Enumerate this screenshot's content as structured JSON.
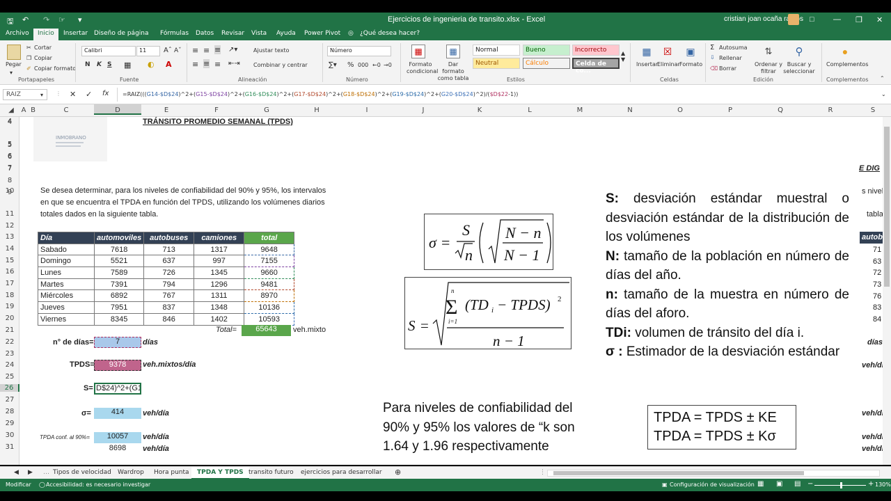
{
  "title_bar": {
    "window_title": "Ejercicios de ingenieria de transito.xlsx  -  Excel",
    "user": "cristian joan ocaña ramos"
  },
  "menu_tabs": [
    "Archivo",
    "Inicio",
    "Insertar",
    "Diseño de página",
    "Fórmulas",
    "Datos",
    "Revisar",
    "Vista",
    "Ayuda",
    "Power Pivot",
    "¿Qué desea hacer?"
  ],
  "ribbon": {
    "clipboard": {
      "paste": "Pegar",
      "cut": "Cortar",
      "copy": "Copiar",
      "format_painter": "Copiar formato",
      "group": "Portapapeles"
    },
    "font": {
      "name": "Calibri",
      "size": "11",
      "bold": "N",
      "italic": "K",
      "underline": "S",
      "group": "Fuente"
    },
    "alignment": {
      "wrap": "Ajustar texto",
      "merge": "Combinar y centrar",
      "group": "Alineación"
    },
    "number": {
      "format": "Número",
      "group": "Número"
    },
    "styles": {
      "conditional": "Formato condicional",
      "table": "Dar formato como tabla",
      "normal": "Normal",
      "good": "Bueno",
      "bad": "Incorrecto",
      "neutral": "Neutral",
      "calc": "Cálculo",
      "check": "Celda de co...",
      "group": "Estilos"
    },
    "cells": {
      "insert": "Insertar",
      "delete": "Eliminar",
      "format": "Formato",
      "group": "Celdas"
    },
    "editing": {
      "autosum": "Autosuma",
      "fill": "Rellenar",
      "clear": "Borrar",
      "sort": "Ordenar y filtrar",
      "find": "Buscar y seleccionar",
      "group": "Edición"
    },
    "addins": {
      "label": "Complementos",
      "group": "Complementos"
    }
  },
  "formula_bar": {
    "name_box": "RAIZ",
    "fx": "fx",
    "parts": [
      "=RAIZ(((",
      "G14-$D$24",
      ")^2+(",
      "G15-$D$24",
      ")^2+(",
      "G16-$D$24",
      ")^2+(",
      "G17-$D$24",
      ")^2+(",
      "G18-$D$24",
      ")^2+(",
      "G19-$D$24",
      ")^2+(",
      "G20-$D$24",
      ")^2)/(",
      "$D$22",
      "-1))"
    ]
  },
  "columns": [
    "A",
    "B",
    "C",
    "D",
    "E",
    "F",
    "G",
    "H",
    "I",
    "J",
    "K",
    "L",
    "M",
    "N",
    "O",
    "P",
    "Q",
    "R",
    "S"
  ],
  "rows": [
    "4",
    "5",
    "6",
    "7",
    "8",
    "9",
    "10",
    "11",
    "12",
    "13",
    "14",
    "15",
    "16",
    "17",
    "18",
    "19",
    "20",
    "21",
    "22",
    "23",
    "24",
    "25",
    "26",
    "27",
    "28",
    "29",
    "30",
    "31"
  ],
  "sheet": {
    "logo": "INMOBRANO",
    "heading": "TRÁNSITO PROMEDIO SEMANAL (TPDS)",
    "right_cut": "E DIG",
    "intro": [
      "Se desea determinar, para los niveles de confiabilidad del 90% y 95%, los intervalos",
      "en que se encuentra el TPDA en función del TPDS, utilizando los volúmenes diarios",
      "totales dados en la siguiente tabla."
    ],
    "table": {
      "headers": [
        "Día",
        "automoviles",
        "autobuses",
        "camiones",
        "total"
      ],
      "rows": [
        [
          "Sabado",
          "7618",
          "713",
          "1317",
          "9648"
        ],
        [
          "Domingo",
          "5521",
          "637",
          "997",
          "7155"
        ],
        [
          "Lunes",
          "7589",
          "726",
          "1345",
          "9660"
        ],
        [
          "Martes",
          "7391",
          "794",
          "1296",
          "9481"
        ],
        [
          "Miércoles",
          "6892",
          "767",
          "1311",
          "8970"
        ],
        [
          "Jueves",
          "7951",
          "837",
          "1348",
          "10136"
        ],
        [
          "Viernes",
          "8345",
          "846",
          "1402",
          "10593"
        ]
      ],
      "total_label": "Total=",
      "total_value": "65643",
      "total_unit": "veh.mixto"
    },
    "calc": {
      "ndias_label": "n° de días=",
      "ndias_value": "7",
      "ndias_unit": "días",
      "tpds_label": "TPDS=",
      "tpds_value": "9378",
      "tpds_unit": "veh.mixtos/día",
      "s_label": "S=",
      "s_value": "D$24)^2+(G1",
      "sigma_label": "σ=",
      "sigma_value": "414",
      "sigma_unit": "veh/día",
      "tpda90_label": "TPDA conf. al 90%=",
      "tpda90_value": "10057",
      "tpda90_unit": "veh/día",
      "tpda90_low": "8698",
      "tpda90_low_unit": "veh/día"
    },
    "definitions": [
      {
        "term": "S:",
        "text": " desviación estándar muestral o desviación estándar de la distribución de los volúmenes"
      },
      {
        "term": "N:",
        "text": " tamaño de la población en número de días del año."
      },
      {
        "term": "n:",
        "text": " tamaño de la muestra en número de días del aforo."
      },
      {
        "term": "TDi:",
        "text": "  volumen de tránsito del día i."
      },
      {
        "term": "σ :",
        "text": "  Estimador de la desviación estándar"
      }
    ],
    "k_note": "Para niveles de confiabilidad del 90% y 95% los valores de “k son 1.64 y 1.96 respectivamente",
    "tpda_box": [
      "TPDA = TPDS ± KE",
      "TPDA = TPDS ± Kσ"
    ],
    "right_partial": {
      "r10": "s nivele",
      "r11": "tabla.",
      "hdr": "autob",
      "vals": [
        "71",
        "63",
        "72",
        "73",
        "76",
        "83",
        "84"
      ],
      "dias": "días",
      "vehdia": "veh/día"
    }
  },
  "sheet_tabs": [
    "Tipos de velocidad",
    "Wardrop",
    "Hora punta",
    "TPDA Y TPDS",
    "transito futuro",
    "ejercicios para desarrollar"
  ],
  "active_tab": "TPDA Y TPDS",
  "status": {
    "mode": "Modificar",
    "accessibility": "Accesibilidad: es necesario investigar",
    "display": "Configuración de visualización",
    "zoom": "130%"
  },
  "colors": {
    "excel_green": "#217346",
    "table_header": "#334155",
    "selected_green": "#5aa64b"
  }
}
